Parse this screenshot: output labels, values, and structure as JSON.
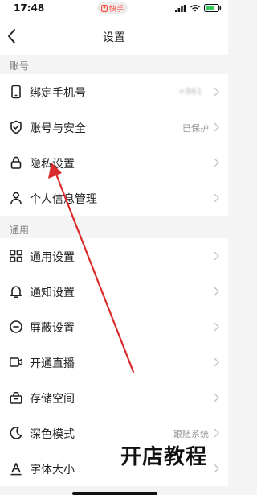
{
  "status_bar": {
    "time": "17:48",
    "app_pill": "快手"
  },
  "nav": {
    "title": "设置"
  },
  "sections": {
    "account": {
      "header": "账号",
      "items": [
        {
          "label": "绑定手机号",
          "value": "+861",
          "icon": "phone-icon"
        },
        {
          "label": "账号与安全",
          "value": "已保护",
          "icon": "shield-check-icon"
        },
        {
          "label": "隐私设置",
          "value": "",
          "icon": "lock-icon"
        },
        {
          "label": "个人信息管理",
          "value": "",
          "icon": "person-icon"
        }
      ]
    },
    "general": {
      "header": "通用",
      "items": [
        {
          "label": "通用设置",
          "value": "",
          "icon": "grid-icon"
        },
        {
          "label": "通知设置",
          "value": "",
          "icon": "bell-icon"
        },
        {
          "label": "屏蔽设置",
          "value": "",
          "icon": "block-icon"
        },
        {
          "label": "开通直播",
          "value": "",
          "icon": "live-camera-icon"
        },
        {
          "label": "存储空间",
          "value": "",
          "icon": "storage-box-icon"
        },
        {
          "label": "深色模式",
          "value": "跟随系统",
          "icon": "moon-icon"
        },
        {
          "label": "字体大小",
          "value": "",
          "icon": "font-size-icon"
        }
      ]
    }
  },
  "watermark": {
    "text": "开店教程"
  },
  "colors": {
    "accent_arrow": "#d92b2b",
    "pill_text": "#ff4d3a",
    "battery_green": "#34c759"
  }
}
